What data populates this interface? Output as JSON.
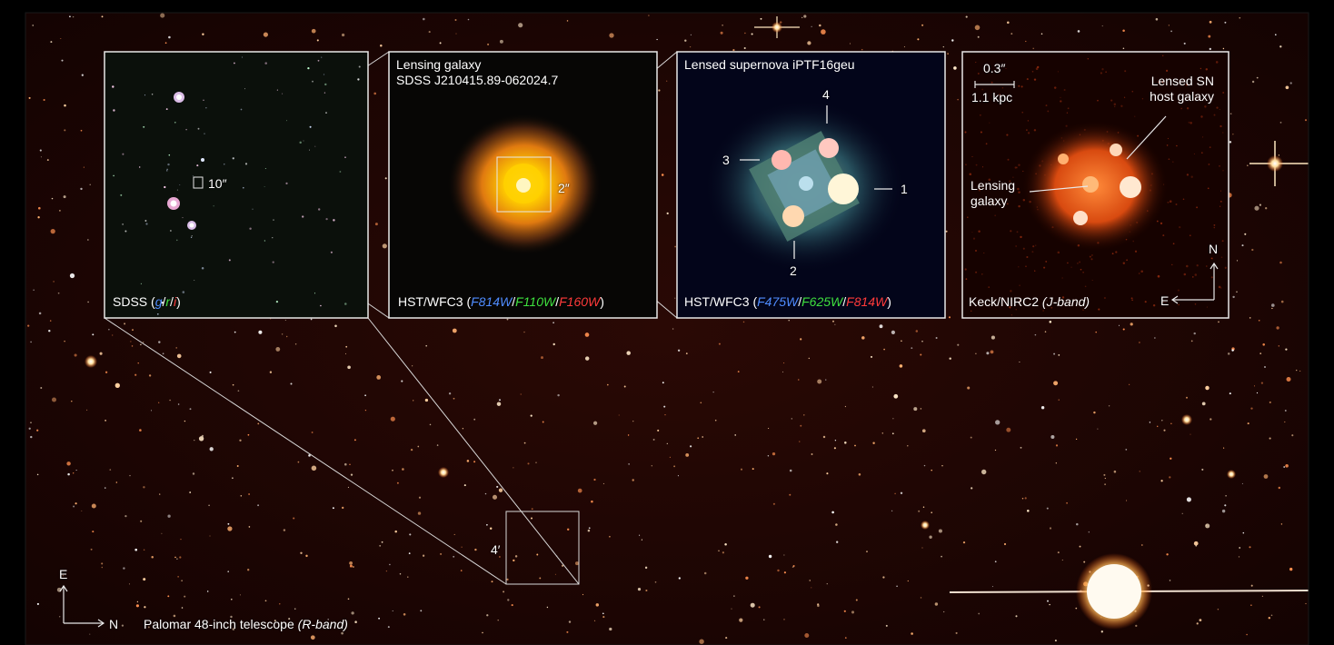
{
  "colors": {
    "sky": "#1a0402",
    "border": "#e8e8e8",
    "blue_filter": "#4f8cff",
    "green_filter": "#3ee03e",
    "red_filter": "#ff3a3a"
  },
  "panel1": {
    "caption_prefix": "SDSS (",
    "band_g": "g",
    "slash1": "/",
    "band_r": "r",
    "slash2": "/",
    "band_i": "i",
    "caption_suffix": ")",
    "scale": "10″"
  },
  "panel2": {
    "title_line1": "Lensing galaxy",
    "title_line2": "SDSS J210415.89-062024.7",
    "caption_prefix": "HST/WFC3 (",
    "f1": "F814W",
    "slash1": "/",
    "f2": "F110W",
    "slash2": "/",
    "f3": "F160W",
    "caption_suffix": ")",
    "scale": "2″"
  },
  "panel3": {
    "title": "Lensed supernova iPTF16geu",
    "img1": "1",
    "img2": "2",
    "img3": "3",
    "img4": "4",
    "caption_prefix": "HST/WFC3 (",
    "f1": "F475W",
    "slash1": "/",
    "f2": "F625W",
    "slash2": "/",
    "f3": "F814W",
    "caption_suffix": ")"
  },
  "panel4": {
    "scale_arcsec": "0.3″",
    "scale_kpc": "1.1 kpc",
    "host_label_line1": "Lensed SN",
    "host_label_line2": "host galaxy",
    "lens_label_line1": "Lensing",
    "lens_label_line2": "galaxy",
    "caption_prefix": "Keck/NIRC2 ",
    "caption_band": "(J-band)",
    "compass_n": "N",
    "compass_e": "E"
  },
  "main": {
    "scale_box": "4′",
    "compass_e": "E",
    "compass_n": "N",
    "caption_prefix": "Palomar 48-inch telescope ",
    "caption_band": "(R-band)"
  }
}
